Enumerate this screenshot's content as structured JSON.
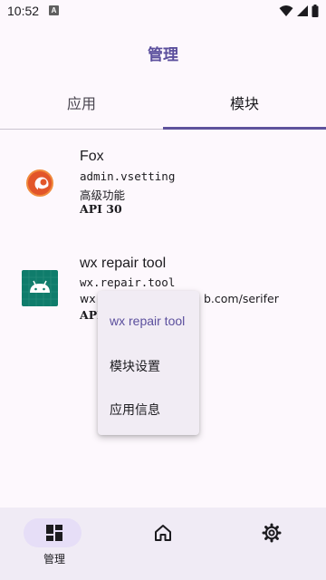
{
  "status_bar": {
    "time": "10:52",
    "notification_letter": "A"
  },
  "app_bar": {
    "title": "管理"
  },
  "tabs": [
    {
      "label": "应用",
      "selected": false
    },
    {
      "label": "模块",
      "selected": true
    }
  ],
  "modules": [
    {
      "name": "Fox",
      "package": "admin.vsetting",
      "description": "高级功能",
      "api": "API  30"
    },
    {
      "name": "wx repair tool",
      "package": "wx.repair.tool",
      "description_visible": "wx",
      "description_tail": "b.com/serifer",
      "api": "API"
    }
  ],
  "context_menu": {
    "items": [
      "wx repair tool",
      "模块设置",
      "应用信息"
    ]
  },
  "bottom_nav": [
    {
      "label": "管理",
      "icon": "dashboard-icon",
      "selected": true
    },
    {
      "label": "",
      "icon": "home-icon",
      "selected": false
    },
    {
      "label": "",
      "icon": "settings-icon",
      "selected": false
    }
  ],
  "colors": {
    "accent": "#5e529c",
    "background": "#fdf8fd",
    "nav_background": "#f0ebf5",
    "menu_background": "#f1ecf4"
  }
}
